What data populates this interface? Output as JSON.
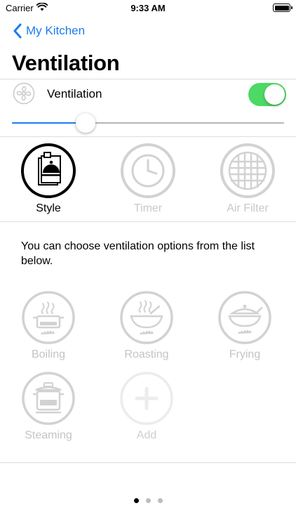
{
  "status_bar": {
    "carrier": "Carrier",
    "time": "9:33 AM"
  },
  "nav": {
    "back_label": "My Kitchen",
    "title": "Ventilation"
  },
  "ventilation_row": {
    "label": "Ventilation",
    "toggle_on": true,
    "toggle_color": "#4cd964"
  },
  "fan_slider": {
    "value": 0.27,
    "fill_color": "#1a7cf0"
  },
  "modes": [
    {
      "label": "Style",
      "icon": "cooking-style-icon",
      "selected": true
    },
    {
      "label": "Timer",
      "icon": "timer-clock-icon",
      "selected": false
    },
    {
      "label": "Air Filter",
      "icon": "air-filter-grid-icon",
      "selected": false
    }
  ],
  "description": "You can choose ventilation options from the list below.",
  "options": [
    {
      "label": "Boiling",
      "icon": "boiling-pot-icon"
    },
    {
      "label": "Roasting",
      "icon": "roasting-pan-icon"
    },
    {
      "label": "Frying",
      "icon": "frying-pan-icon"
    },
    {
      "label": "Steaming",
      "icon": "steaming-pot-icon"
    },
    {
      "label": "Add",
      "icon": "add-plus-icon"
    }
  ],
  "page_indicator": {
    "count": 3,
    "current": 0
  },
  "colors": {
    "accent": "#1a7cf0",
    "inactive_gray": "#c8c8c8",
    "switch_green": "#4cd964"
  }
}
